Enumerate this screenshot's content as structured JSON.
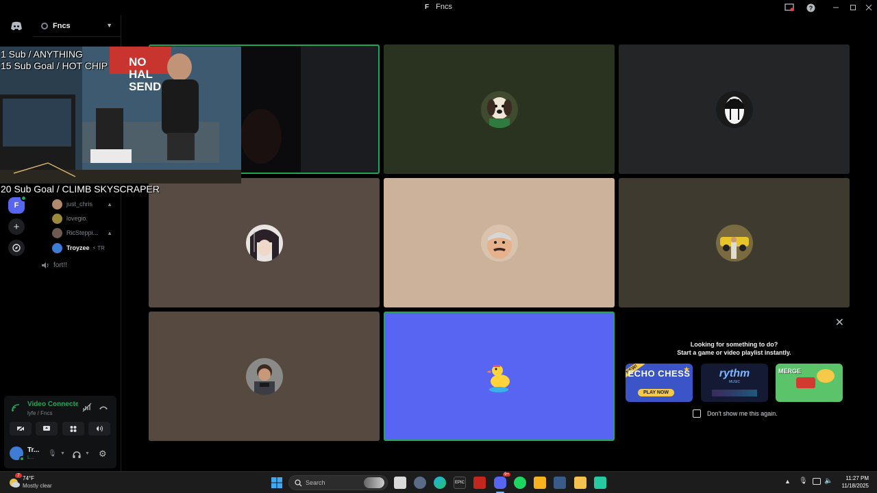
{
  "window": {
    "title_glyph": "F",
    "title": "Fncs"
  },
  "server": {
    "name": "Fncs"
  },
  "rail": {
    "server_letter": "F"
  },
  "members": [
    {
      "name": "just_chris",
      "color": "#b08a6e"
    },
    {
      "name": "lovegio.",
      "color": "#9a8a3a"
    },
    {
      "name": "RicSteppi...",
      "color": "#6e5a52"
    },
    {
      "name": "Troyzee",
      "color": "#3d7dd8",
      "tag": "⚡ TR"
    }
  ],
  "channel": {
    "name": "fort!!"
  },
  "overlay": {
    "line1": "1 Sub / ANYTHING",
    "line2": "15 Sub Goal / HOT CHIP",
    "line3": "20 Sub Goal / CLIMB SKYSCRAPER",
    "banner": "NO HAL SEND"
  },
  "tiles": [
    {
      "bg": "#1b1c1f",
      "speaking": true
    },
    {
      "bg": "#2a3220",
      "avatar": "dog-avatar"
    },
    {
      "bg": "#242526",
      "avatar": "mask-avatar"
    },
    {
      "bg": "#574b44",
      "avatar": "anime-avatar"
    },
    {
      "bg": "#cdb29b",
      "avatar": "cartoon-avatar"
    },
    {
      "bg": "#3e3a2f",
      "avatar": "car-avatar"
    },
    {
      "bg": "#554940",
      "avatar": "person-avatar"
    },
    {
      "bg": "#5865f2",
      "avatar": "duck-avatar",
      "speaking": true
    }
  ],
  "activity": {
    "line1": "Looking for something to do?",
    "line2": "Start a game or video playlist instantly.",
    "dont_show": "Don't show me this again.",
    "cards": [
      {
        "name": "ECHO CHESS",
        "badge": "NEW!",
        "cta": "PLAY NOW"
      },
      {
        "name": "rythm",
        "sub": "MUSIC"
      },
      {
        "name": "MERGE"
      }
    ]
  },
  "voice": {
    "status": "Video Connecte",
    "location": "lyfe / Fncs",
    "user": "Tr...",
    "user_sub": "L..."
  },
  "taskbar": {
    "weather_temp": "74°F",
    "weather_desc": "Mostly clear",
    "search_placeholder": "Search",
    "time": "11:27 PM",
    "date": "11/18/2025",
    "badge": "7",
    "discord_badge": "9+"
  },
  "colors": {
    "accent": "#5865f2",
    "speaking": "#23a559",
    "connected": "#23a559"
  }
}
